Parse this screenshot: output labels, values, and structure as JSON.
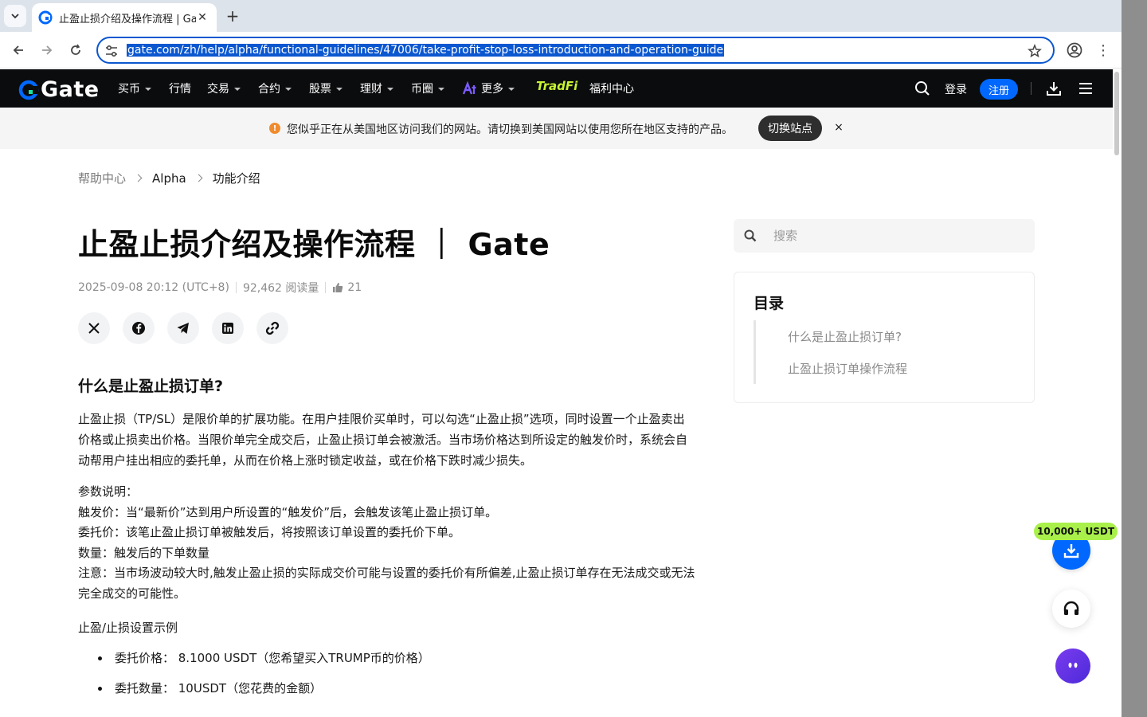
{
  "browser": {
    "tab_title": "止盈止损介绍及操作流程 | Gate",
    "url": "gate.com/zh/help/alpha/functional-guidelines/47006/take-profit-stop-loss-introduction-and-operation-guide"
  },
  "nav": {
    "logo_text": "Gate",
    "items": [
      "买币",
      "行情",
      "交易",
      "合约",
      "股票",
      "理财",
      "币圈",
      "更多",
      "TradFi",
      "福利中心"
    ],
    "login": "登录",
    "register": "注册",
    "brand_color": "#0068ff"
  },
  "notice": {
    "text": "您似乎正在从美国地区访问我们的网站。请切换到美国网站以使用您所在地区支持的产品。",
    "button": "切换站点",
    "close": "×"
  },
  "breadcrumb": [
    "帮助中心",
    "Alpha",
    "功能介绍"
  ],
  "article": {
    "title": "止盈止损介绍及操作流程 ｜ Gate",
    "date": "2025-09-08 20:12 (UTC+8)",
    "views": "92,462 阅读量",
    "likes": "21",
    "heading": "什么是止盈止损订单?",
    "intro": "止盈止损（TP/SL）是限价单的扩展功能。在用户挂限价买单时，可以勾选“止盈止损”选项，同时设置一个止盈卖出价格或止损卖出价格。当限价单完全成交后，止盈止损订单会被激活。当市场价格达到所设定的触发价时，系统会自动帮用户挂出相应的委托单，从而在价格上涨时锁定收益，或在价格下跌时减少损失。",
    "params": [
      "参数说明：",
      "触发价：当“最新价”达到用户所设置的“触发价”后，会触发该笔止盈止损订单。",
      "委托价：该笔止盈止损订单被触发后，将按照该订单设置的委托价下单。",
      "数量：触发后的下单数量",
      "注意：当市场波动较大时,触发止盈止损的实际成交价可能与设置的委托价有所偏差,止盈止损订单存在无法成交或无法完全成交的可能性。"
    ],
    "example_title": "止盈/止损设置示例",
    "bullets": [
      "委托价格：  8.1000 USDT（您希望买入TRUMP币的价格）",
      "委托数量：  10USDT（您花费的金额）"
    ]
  },
  "sidebar": {
    "search_placeholder": "搜索",
    "toc_title": "目录",
    "toc_items": [
      "什么是止盈止损订单?",
      "止盈止损订单操作流程"
    ]
  },
  "floating": {
    "badge": "10,000+ USDT"
  }
}
